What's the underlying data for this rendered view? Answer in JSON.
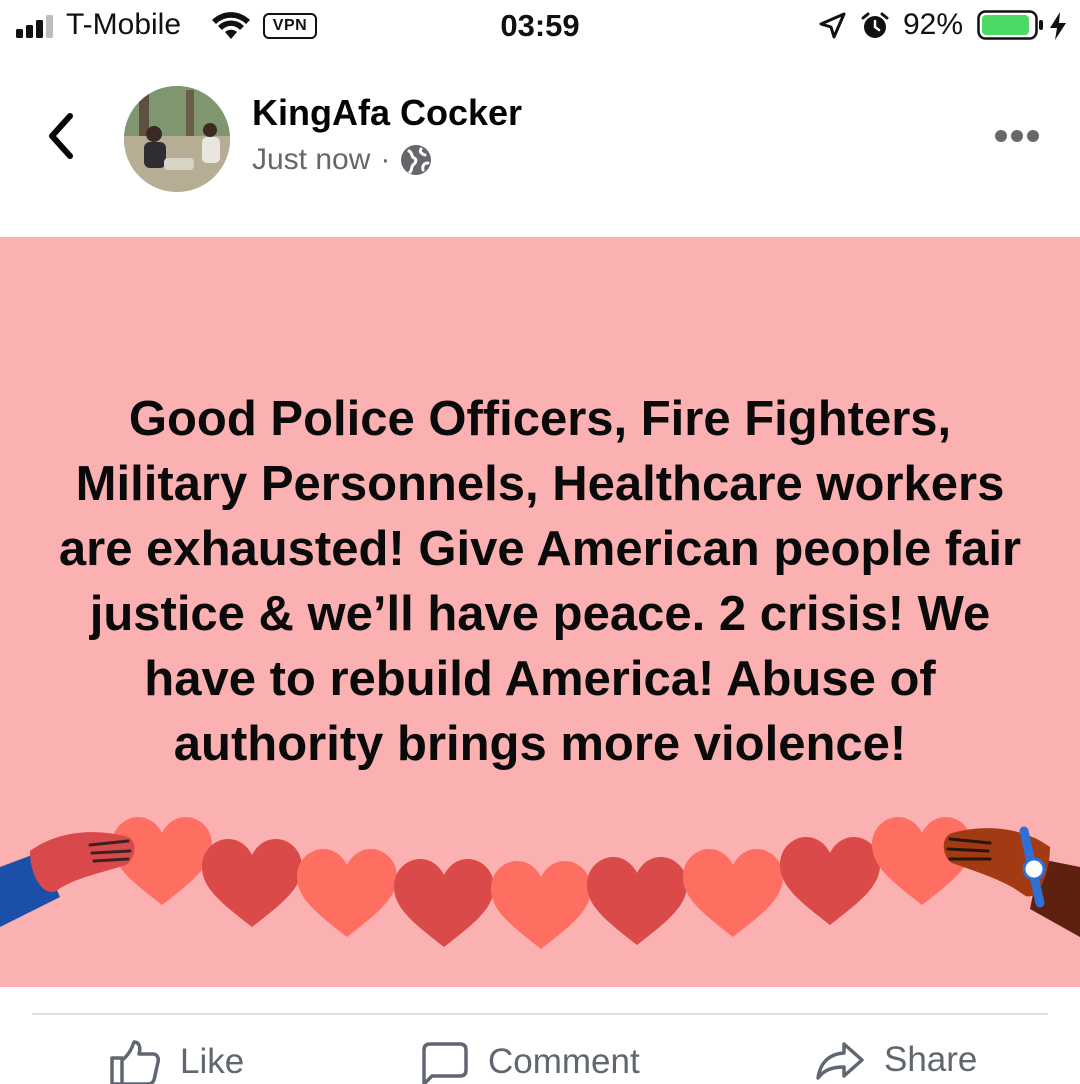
{
  "status_bar": {
    "carrier": "T-Mobile",
    "vpn_label": "VPN",
    "time": "03:59",
    "battery_percent": "92%",
    "battery_level": 0.92,
    "icons": [
      "signal-icon",
      "wifi-icon",
      "location-arrow-icon",
      "alarm-icon",
      "battery-icon",
      "charging-bolt-icon"
    ]
  },
  "post": {
    "author_name": "KingAfa Cocker",
    "timestamp": "Just now",
    "separator": "·",
    "privacy_icon": "globe-icon",
    "background_color": "#fbb1b1",
    "text": "Good Police Officers, Fire Fighters, Military Personnels, Healthcare workers are exhausted! Give American people fair justice & we’ll have peace. 2 crisis! We have to rebuild America! Abuse of authority brings more violence!",
    "art_icon": "heart-garland-hands-illustration"
  },
  "actions": {
    "like_label": "Like",
    "comment_label": "Comment",
    "share_label": "Share"
  },
  "colors": {
    "heart_light": "#ff6f61",
    "heart_dark": "#d94a48",
    "text_secondary": "#65676b",
    "action_gray": "#606770"
  }
}
